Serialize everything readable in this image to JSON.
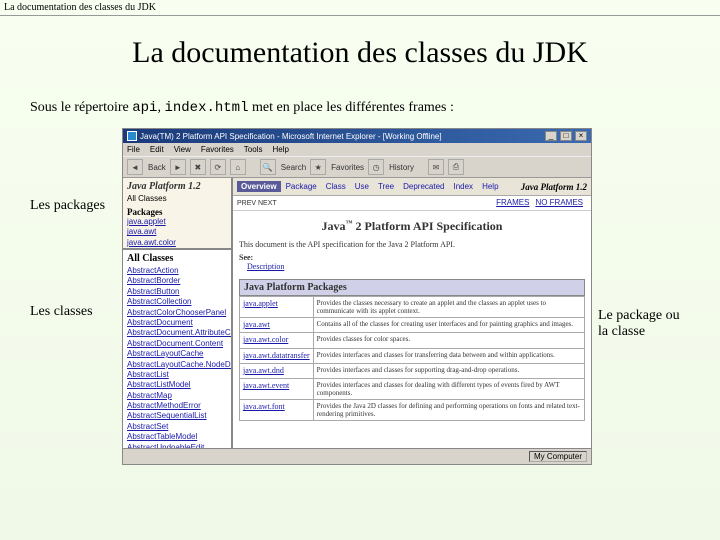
{
  "slide": {
    "header": "La documentation des classes du JDK",
    "title": "La documentation des classes du JDK",
    "intro_pre": "Sous le répertoire ",
    "intro_code1": "api",
    "intro_sep": ", ",
    "intro_code2": "index.html",
    "intro_post": " met en place les différentes frames :",
    "label_packages": "Les packages",
    "label_classes": "Les classes",
    "label_right": "Le package ou la classe"
  },
  "browser": {
    "title": "Java(TM) 2 Platform API Specification - Microsoft Internet Explorer - [Working Offline]",
    "menu": [
      "File",
      "Edit",
      "View",
      "Favorites",
      "Tools",
      "Help"
    ],
    "toolbar": {
      "back": "Back",
      "search": "Search",
      "favorites": "Favorites",
      "history": "History"
    },
    "status_right": "My Computer"
  },
  "pkgframe": {
    "title": "Java Platform 1.2",
    "all": "All Classes",
    "heading": "Packages",
    "items": [
      "java.applet",
      "java.awt",
      "java.awt.color"
    ]
  },
  "clsframe": {
    "heading": "All Classes",
    "items": [
      "AbstractAction",
      "AbstractBorder",
      "AbstractButton",
      "AbstractCollection",
      "AbstractColorChooserPanel",
      "AbstractDocument",
      "AbstractDocument.AttributeContext",
      "AbstractDocument.Content",
      "AbstractLayoutCache",
      "AbstractLayoutCache.NodeDimensions",
      "AbstractList",
      "AbstractListModel",
      "AbstractMap",
      "AbstractMethodError",
      "AbstractSequentialList",
      "AbstractSet",
      "AbstractTableModel",
      "AbstractUndoableEdit"
    ]
  },
  "mainframe": {
    "nav": [
      "Overview",
      "Package",
      "Class",
      "Use",
      "Tree",
      "Deprecated",
      "Index",
      "Help"
    ],
    "brand": "Java Platform 1.2",
    "prevnext": "PREV   NEXT",
    "frames": "FRAMES",
    "noframes": "NO FRAMES",
    "h2_pre": "Java",
    "h2_sup": "™",
    "h2_post": " 2 Platform API Specification",
    "desc": "This document is the API specification for the Java 2 Platform API.",
    "see": "See:",
    "see_link": "Description",
    "table_title": "Java Platform Packages",
    "rows": [
      {
        "name": "java.applet",
        "desc": "Provides the classes necessary to create an applet and the classes an applet uses to communicate with its applet context."
      },
      {
        "name": "java.awt",
        "desc": "Contains all of the classes for creating user interfaces and for painting graphics and images."
      },
      {
        "name": "java.awt.color",
        "desc": "Provides classes for color spaces."
      },
      {
        "name": "java.awt.datatransfer",
        "desc": "Provides interfaces and classes for transferring data between and within applications."
      },
      {
        "name": "java.awt.dnd",
        "desc": "Provides interfaces and classes for supporting drag-and-drop operations."
      },
      {
        "name": "java.awt.event",
        "desc": "Provides interfaces and classes for dealing with different types of events fired by AWT components."
      },
      {
        "name": "java.awt.font",
        "desc": "Provides the Java 2D classes for defining and performing operations on fonts and related text-rendering primitives."
      }
    ]
  }
}
